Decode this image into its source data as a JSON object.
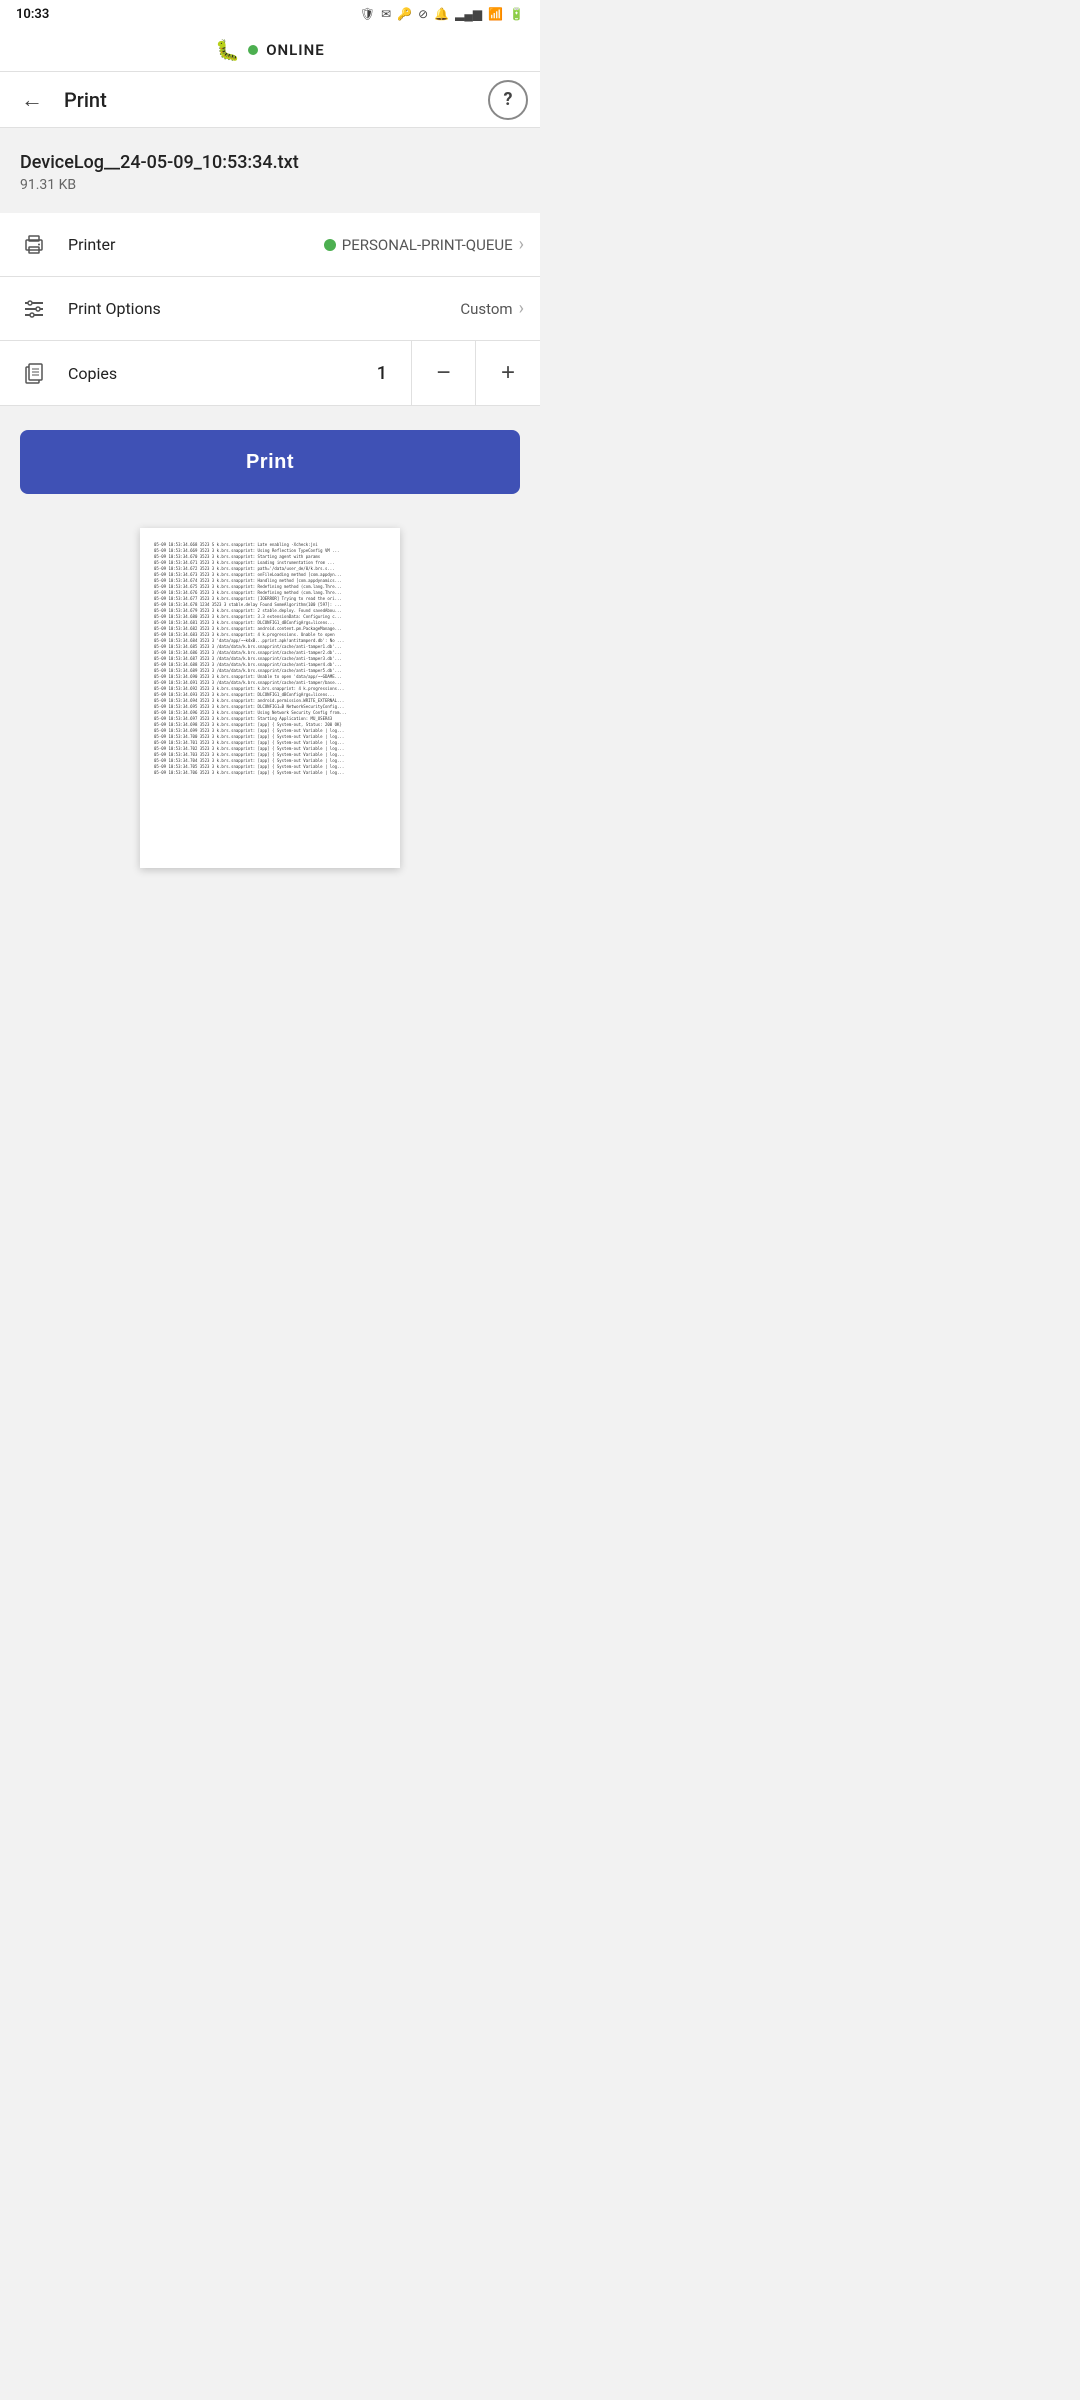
{
  "status_bar": {
    "time": "10:33",
    "icons": [
      "shield",
      "mail",
      "vpn",
      "dnd",
      "notifications_off",
      "signal",
      "wifi",
      "battery"
    ]
  },
  "top_banner": {
    "bug_icon": "🐛",
    "online_label": "ONLINE"
  },
  "header": {
    "title": "Print",
    "back_icon": "←",
    "help_icon": "?"
  },
  "file": {
    "name": "DeviceLog__24-05-09_10:53:34.txt",
    "size": "91.31 KB"
  },
  "printer_row": {
    "icon": "🖨",
    "label": "Printer",
    "value": "PERSONAL-PRINT-QUEUE"
  },
  "print_options_row": {
    "icon": "≡",
    "label": "Print Options",
    "value": "Custom"
  },
  "copies_row": {
    "icon": "📄",
    "label": "Copies",
    "value": "1",
    "minus_label": "−",
    "plus_label": "+"
  },
  "print_button": {
    "label": "Print"
  },
  "preview": {
    "lines": [
      "05-09 10:53:34.668  3523 S k.brs.snapprint: Late enabling -Xcheck:jni",
      "05-09 10:53:34.669  3523 3 k.brs.snapprint: Using Reflection TypeConfig VM ...",
      "05-09 10:53:34.670  3523 3 k.brs.snapprint: Starting agent with params",
      "05-09 10:53:34.671  3523 3 k.brs.snapprint: Loading instrumentation from ...",
      "05-09 10:53:34.672  3523 3 k.brs.snapprint: path='/data/user_de/0/k.brs.s...",
      "05-09 10:53:34.673  3523 3 k.brs.snapprint: onFileLoading method [com.appdyn...",
      "05-09 10:53:34.674  3523 3 k.brs.snapprint: Handling method [com.appdynamics...",
      "05-09 10:53:34.675  3523 3 k.brs.snapprint: Redefining method (com.lang.Thre...",
      "05-09 10:53:34.676  3523 3 k.brs.snapprint: Redefining method (com.lang.Thre...",
      "05-09 10:53:34.677  3523 3 k.brs.snapprint: [IOERROR] Trying to read the ori...",
      "05-09 10:53:34.678  1234  3523 3 stable.delay Found SomeAlgorithm(100 [597]: ...",
      "05-09 10:53:34.679  3523 3 k.brs.snapprint: 2 stable.deploy. Found savedAbou...",
      "05-09 10:53:34.680  3523 3 k.brs.snapprint: 3.3 extensionData: Configuring c...",
      "05-09 10:53:34.681  3523 3 k.brs.snapprint: DLCONFIG1_dBConfigArgs=licens...",
      "05-09 10:53:34.682  3523 3 k.brs.snapprint: android.content.pm.PackageManage...",
      "05-09 10:53:34.683  3523 3 k.brs.snapprint: 4 k.progressions. Unable to open",
      "05-09 10:53:34.684  3523 3 'data/app/~~k4xB...pprint.apk!antitamperd.db': No ...",
      "05-09 10:53:34.685  3523 3 /data/data/k.brs.snapprint/cache/anti-tamper1.db'...",
      "05-09 10:53:34.686  3523 3 /data/data/k.brs.snapprint/cache/anti-tamper2.db'...",
      "05-09 10:53:34.687  3523 3 /data/data/k.brs.snapprint/cache/anti-tamper3.db'...",
      "05-09 10:53:34.688  3523 3 /data/data/k.brs.snapprint/cache/anti-tamper4.db'...",
      "05-09 10:53:34.689  3523 3 /data/data/k.brs.snapprint/cache/anti-tamper5.db'...",
      "05-09 10:53:34.690  3523 3 k.brs.snapprint: Unable to open 'data/app/~~GDAME...",
      "05-09 10:53:34.691  3523 3 /data/data/k.brs.snapprint/cache/anti-tamper/base...",
      "05-09 10:53:34.692  3523 3 k.brs.snapprint: k.brs.snapprint: 4 k.progressions...",
      "05-09 10:53:34.693  3523 3 k.brs.snapprint: DLCONFIG1_dBConfigArgs=licens...",
      "05-09 10:53:34.694  3523 3 k.brs.snapprint: android.permission.WRITE_EXTERNAL...",
      "05-09 10:53:34.695  3523 3 k.brs.snapprint: DLCONFIG1=B NetworkSecurityConfig...",
      "05-09 10:53:34.696  3523 3 k.brs.snapprint: Using Network Security Config from...",
      "05-09 10:53:34.697  3523 3 k.brs.snapprint: Starting Application: MU_USER43",
      "05-09 10:53:34.698  3523 3 k.brs.snapprint: [app] { System-out, Status: 200 OK}",
      "05-09 10:53:34.699  3523 3 k.brs.snapprint: [app] { System-out Variable | log...",
      "05-09 10:53:34.700  3523 3 k.brs.snapprint: [app] { System-out Variable | log...",
      "05-09 10:53:34.701  3523 3 k.brs.snapprint: [app] { System-out Variable | log...",
      "05-09 10:53:34.702  3523 3 k.brs.snapprint: [app] { System-out Variable | log...",
      "05-09 10:53:34.703  3523 3 k.brs.snapprint: [app] { System-out Variable | log...",
      "05-09 10:53:34.704  3523 3 k.brs.snapprint: [app] { System-out Variable | log...",
      "05-09 10:53:34.705  3523 3 k.brs.snapprint: [app] { System-out Variable | log...",
      "05-09 10:53:34.706  3523 3 k.brs.snapprint: [app] { System-out Variable | log..."
    ]
  },
  "colors": {
    "accent": "#3f51b5",
    "online": "#4caf50",
    "bg": "#f2f2f2"
  }
}
